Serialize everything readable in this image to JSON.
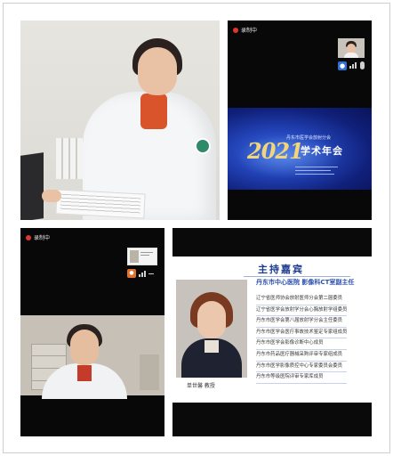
{
  "recording_label": "录制中",
  "top_right": {
    "slide": {
      "year": "2021",
      "title": "学术年会",
      "subtitle": "丹东市医学会放射分会"
    }
  },
  "bottom_right": {
    "title": "主持嘉宾",
    "subtitle": "丹东市中心医院 影像科CT室副主任",
    "roles": [
      "辽宁省医师协会放射医师分会第二届委员",
      "辽宁省医学会放射学分会心胸放射学组委员",
      "丹东市医学会第八届放射学分会主任委员",
      "丹东市医学会医疗事故技术鉴定专家组成员",
      "丹东市医学会影像诊断中心成员",
      "丹东市药品医疗器械采购评审专家组成员",
      "丹东市医学影像质控中心专家委员会委员",
      "丹东市等级医院评审专家库成员"
    ],
    "caption": "单世馨 教授"
  }
}
